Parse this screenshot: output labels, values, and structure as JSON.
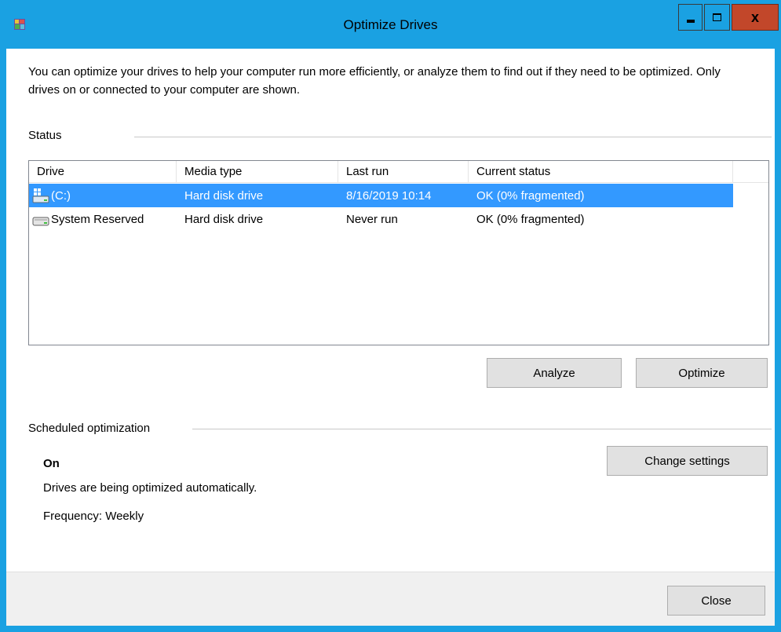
{
  "window": {
    "title": "Optimize Drives",
    "close_glyph": "x",
    "accent_color": "#1aa1e2",
    "close_color": "#c2472a"
  },
  "intro": "You can optimize your drives to help your computer run more efficiently, or analyze them to find out if they need to be optimized. Only drives on or connected to your computer are shown.",
  "status": {
    "title": "Status",
    "columns": [
      "Drive",
      "Media type",
      "Last run",
      "Current status"
    ],
    "rows": [
      {
        "drive": "(C:)",
        "icon": "system-drive-icon",
        "media_type": "Hard disk drive",
        "last_run": "8/16/2019 10:14",
        "current_status": "OK (0% fragmented)",
        "selected": true
      },
      {
        "drive": "System Reserved",
        "icon": "hard-drive-icon",
        "media_type": "Hard disk drive",
        "last_run": "Never run",
        "current_status": "OK (0% fragmented)",
        "selected": false
      }
    ],
    "selection_color": "#3399ff"
  },
  "buttons": {
    "analyze": "Analyze",
    "optimize": "Optimize",
    "change_settings": "Change settings",
    "close": "Close"
  },
  "scheduled": {
    "title": "Scheduled optimization",
    "state": "On",
    "description": "Drives are being optimized automatically.",
    "frequency": "Frequency: Weekly"
  }
}
